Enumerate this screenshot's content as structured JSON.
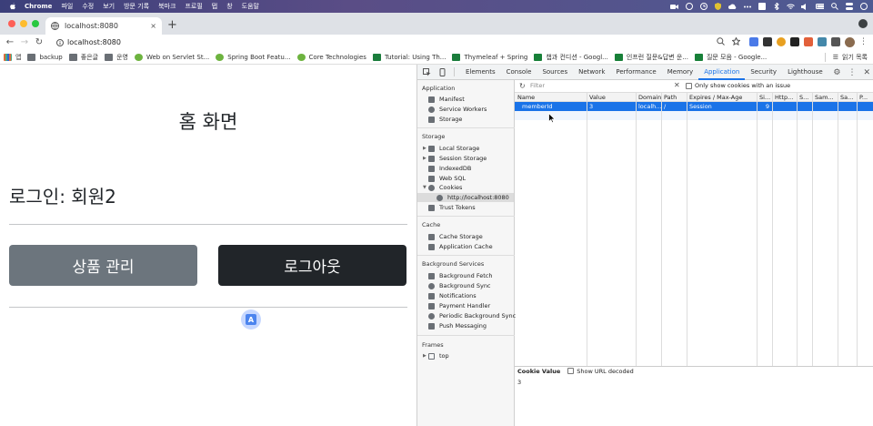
{
  "menubar": {
    "app": "Chrome",
    "items": [
      "파일",
      "수정",
      "보기",
      "방문 기록",
      "북마크",
      "프로필",
      "탭",
      "창",
      "도움말"
    ]
  },
  "tab": {
    "title": "localhost:8080",
    "close": "×"
  },
  "address": {
    "url": "localhost:8080"
  },
  "bookmarks": {
    "items": [
      {
        "label": "앱",
        "icon": "grid"
      },
      {
        "label": "backup",
        "icon": "folder"
      },
      {
        "label": "좋은글",
        "icon": "folder"
      },
      {
        "label": "운영",
        "icon": "folder"
      },
      {
        "label": "Web on Servlet St...",
        "icon": "spring"
      },
      {
        "label": "Spring Boot Featu...",
        "icon": "spring"
      },
      {
        "label": "Core Technologies",
        "icon": "spring"
      },
      {
        "label": "Tutorial: Using Th...",
        "icon": "check"
      },
      {
        "label": "Thymeleaf + Spring",
        "icon": "check"
      },
      {
        "label": "챕과 컨디션 - Googl...",
        "icon": "sheet"
      },
      {
        "label": "인프런 질문&답변 운...",
        "icon": "sheet"
      },
      {
        "label": "질문 모음 - Google...",
        "icon": "sheet"
      }
    ],
    "reading_list": "읽기 목록"
  },
  "page": {
    "title": "홈 화면",
    "login_text": "로그인: 회원2",
    "btn_items": "상품 관리",
    "btn_logout": "로그아웃",
    "colors": {
      "secondary": "#6c757d",
      "dark": "#212529"
    }
  },
  "devtools": {
    "tabs": [
      "Elements",
      "Console",
      "Sources",
      "Network",
      "Performance",
      "Memory",
      "Application",
      "Security",
      "Lighthouse"
    ],
    "active_tab": "Application",
    "sidebar": {
      "application": {
        "header": "Application",
        "items": [
          "Manifest",
          "Service Workers",
          "Storage"
        ]
      },
      "storage": {
        "header": "Storage",
        "items": [
          "Local Storage",
          "Session Storage",
          "IndexedDB",
          "Web SQL",
          "Cookies",
          "http://localhost:8080",
          "Trust Tokens"
        ]
      },
      "cache": {
        "header": "Cache",
        "items": [
          "Cache Storage",
          "Application Cache"
        ]
      },
      "background": {
        "header": "Background Services",
        "items": [
          "Background Fetch",
          "Background Sync",
          "Notifications",
          "Payment Handler",
          "Periodic Background Sync",
          "Push Messaging"
        ]
      },
      "frames": {
        "header": "Frames",
        "items": [
          "top"
        ]
      }
    },
    "filter": {
      "placeholder": "Filter",
      "only_issue": "Only show cookies with an issue"
    },
    "columns": [
      "Name",
      "Value",
      "Domain",
      "Path",
      "Expires / Max-Age",
      "Si...",
      "Http...",
      "S...",
      "Sam...",
      "Sa...",
      "P..."
    ],
    "rows": [
      [
        "memberId",
        "3",
        "localh...",
        "/",
        "Session",
        "9",
        "",
        "",
        "",
        "",
        ""
      ]
    ],
    "cookie_value": {
      "label": "Cookie Value",
      "decode": "Show URL decoded",
      "value": "3"
    }
  }
}
